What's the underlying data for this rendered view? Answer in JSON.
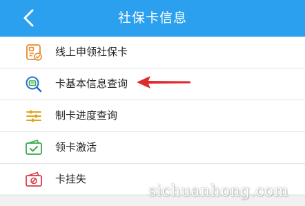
{
  "header": {
    "title": "社保卡信息",
    "back_icon": "chevron-left-icon",
    "background": "#2aa0ef"
  },
  "menu": {
    "items": [
      {
        "label": "线上申领社保卡",
        "icon": "application-form-icon",
        "color": "#e8892a"
      },
      {
        "label": "卡基本信息查询",
        "icon": "search-card-icon",
        "color": "#1f6fd1"
      },
      {
        "label": "制卡进度查询",
        "icon": "progress-sliders-icon",
        "color": "#e0a41e"
      },
      {
        "label": "领卡激活",
        "icon": "card-check-icon",
        "color": "#3aa84b"
      },
      {
        "label": "卡挂失",
        "icon": "card-lost-icon",
        "color": "#d93a4a"
      }
    ]
  },
  "annotation": {
    "arrow_color": "#e02b2b",
    "points_to": "卡基本信息查询"
  },
  "watermark": {
    "text": "sichuanhong.com"
  }
}
